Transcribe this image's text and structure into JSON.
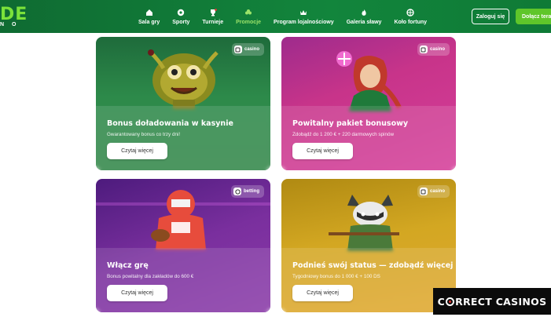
{
  "header": {
    "logo_text": "DE",
    "logo_sub": "N O",
    "nav": [
      {
        "label": "Sala gry",
        "icon": "home-icon"
      },
      {
        "label": "Sporty",
        "icon": "ball-icon"
      },
      {
        "label": "Turnieje",
        "icon": "trophy-icon"
      },
      {
        "label": "Promocje",
        "icon": "clover-icon",
        "active": true
      },
      {
        "label": "Program lojalnościowy",
        "icon": "crown-icon"
      },
      {
        "label": "Galeria sławy",
        "icon": "flame-icon"
      },
      {
        "label": "Koło fortuny",
        "icon": "wheel-icon"
      }
    ],
    "login_label": "Zaloguj się",
    "join_label": "Dołącz teraz"
  },
  "cards": [
    {
      "badge": "casino",
      "title": "Bonus doładowania w kasynie",
      "subtitle": "Gwarantowany bonus co trzy dni!",
      "cta": "Czytaj więcej"
    },
    {
      "badge": "casino",
      "title": "Powitalny pakiet bonusowy",
      "subtitle": "Zdobądź do 1 200 € + 220 darmowych spinów",
      "cta": "Czytaj więcej"
    },
    {
      "badge": "betting",
      "title": "Włącz grę",
      "subtitle": "Bonus powitalny dla zakładów do 600 €",
      "cta": "Czytaj więcej"
    },
    {
      "badge": "casino",
      "title": "Podnieś swój status — zdobądź więcej n...",
      "subtitle": "Tygodniowy bonus do 1 000 € + 100 DS",
      "cta": "Czytaj więcej"
    }
  ],
  "watermark": {
    "pre": "C",
    "post": "RRECT CASINOS"
  },
  "colors": {
    "header": "#12853c",
    "accent_green": "#5fc62a",
    "active_nav": "#9be36a"
  }
}
